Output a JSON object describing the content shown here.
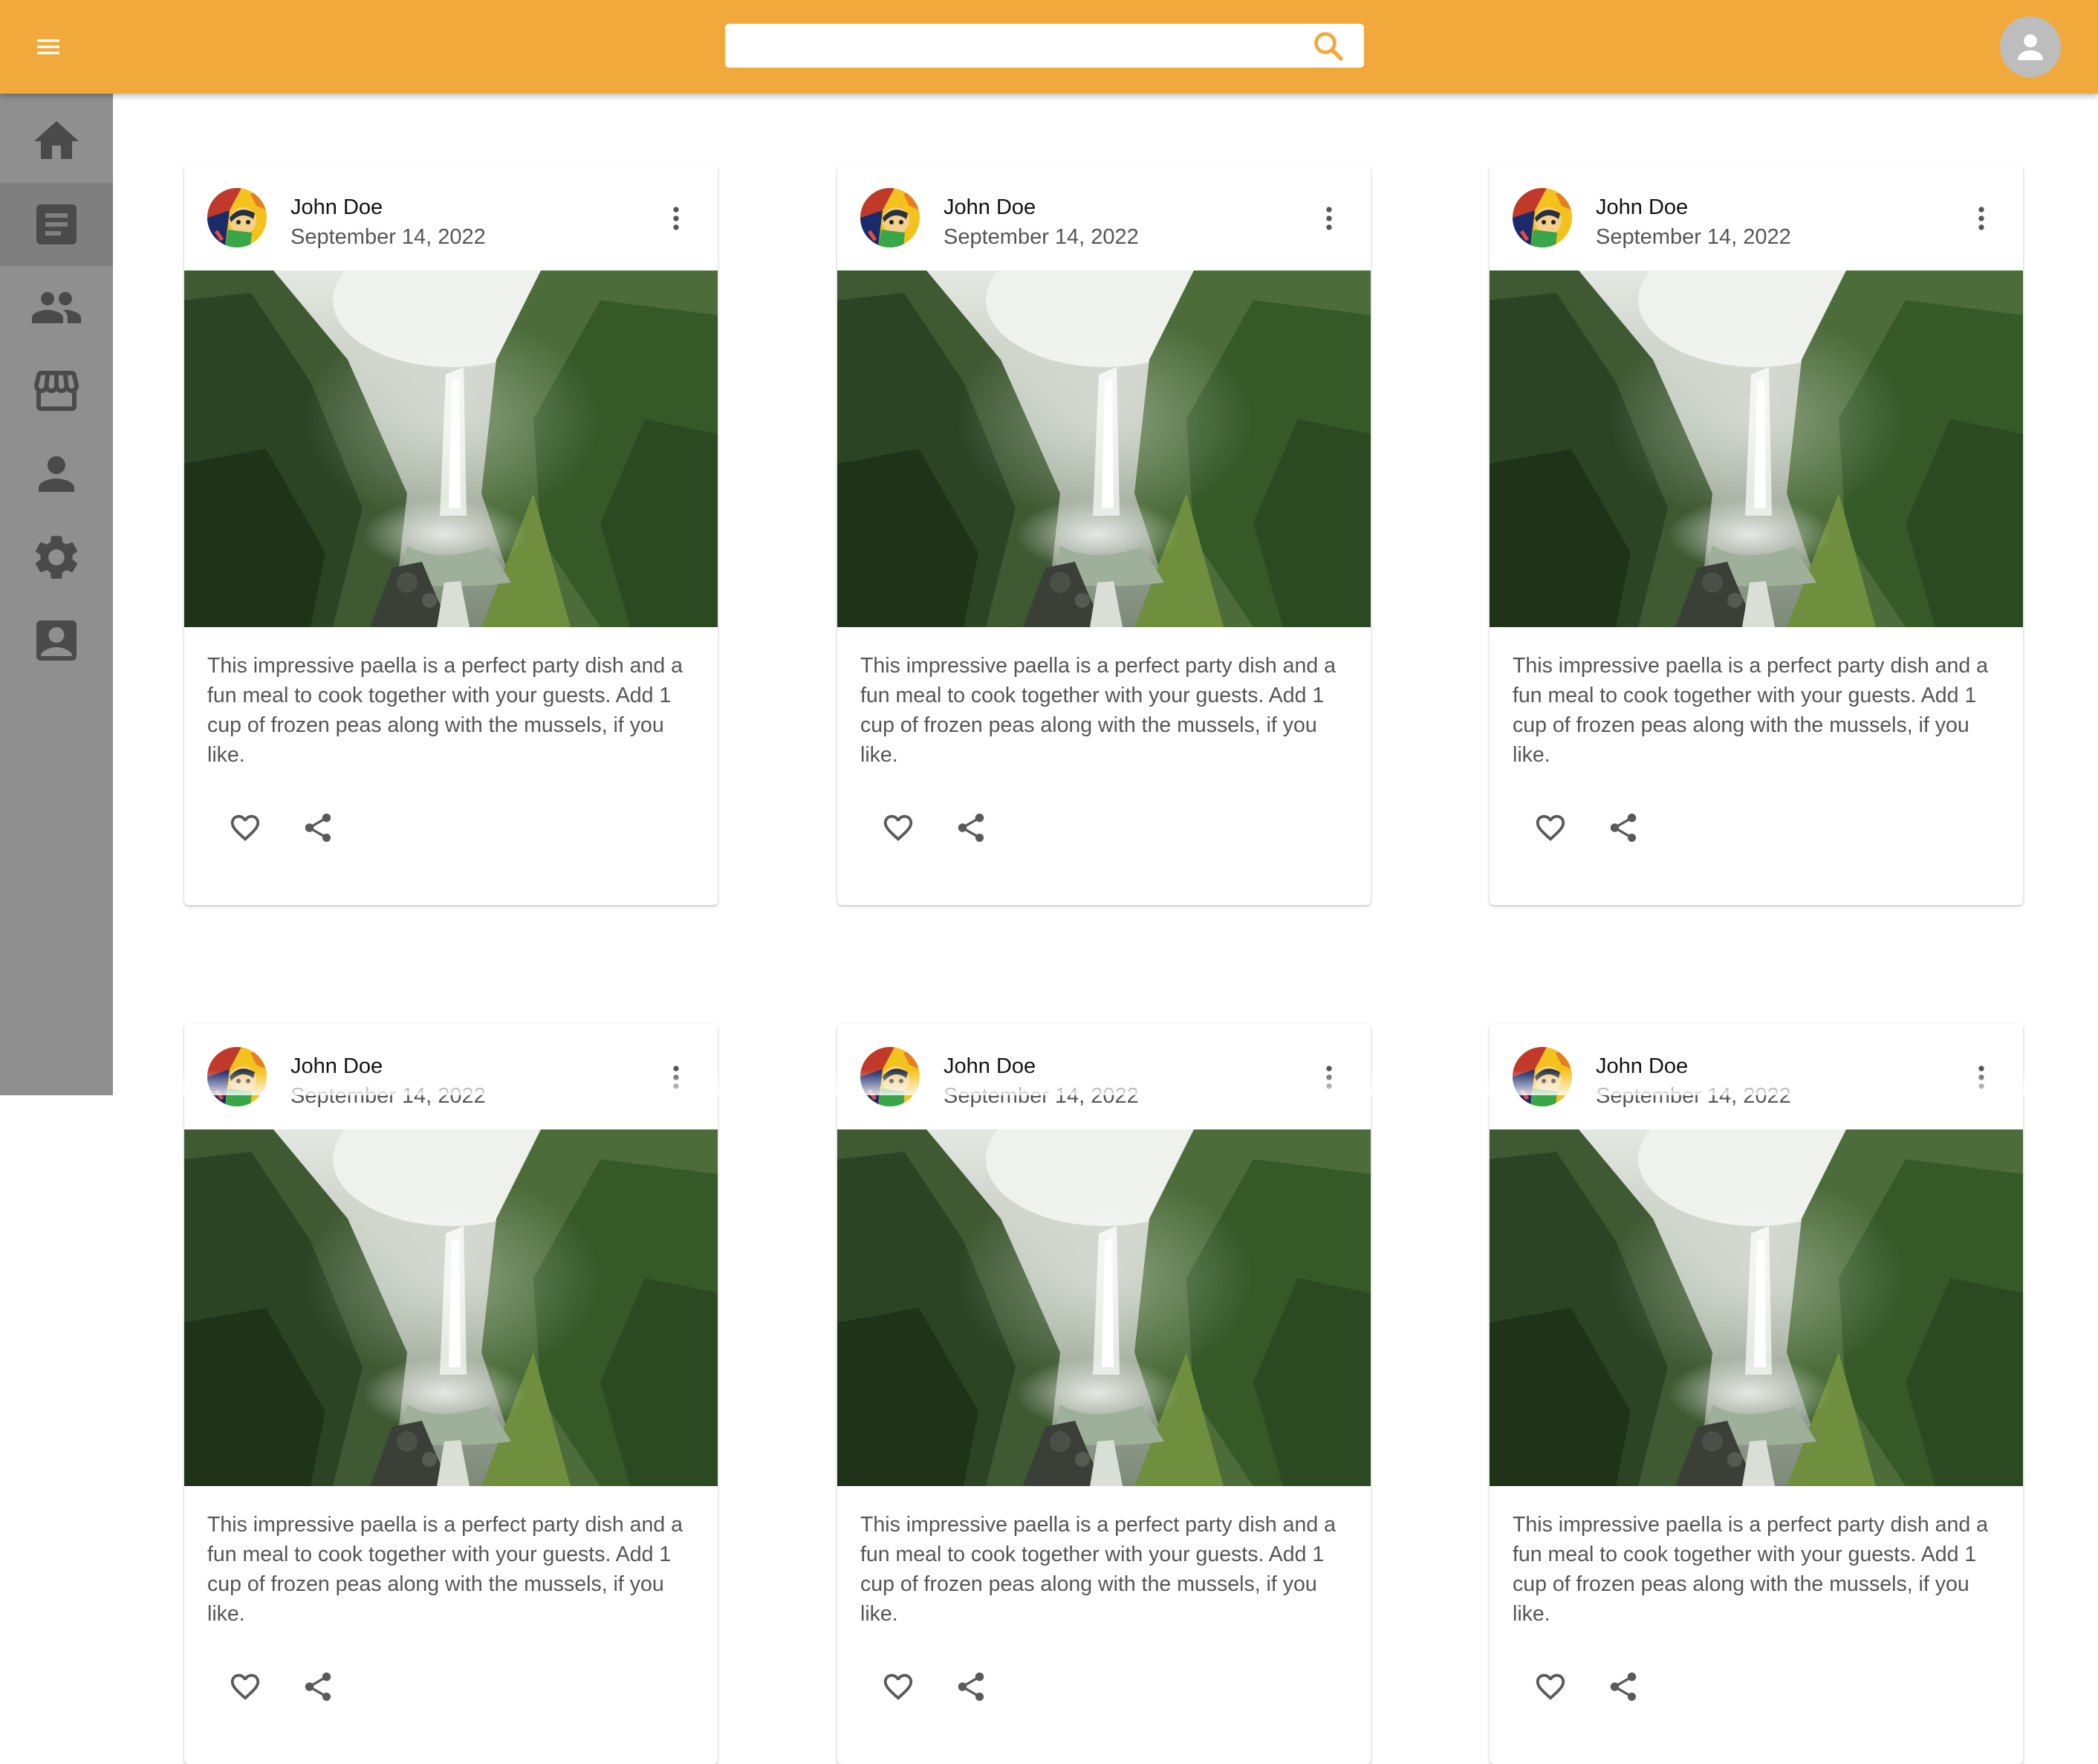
{
  "header": {
    "search": {
      "value": "",
      "placeholder": ""
    },
    "menu_icon": "menu-icon",
    "search_icon": "search-icon",
    "account_icon": "account-icon"
  },
  "sidebar": {
    "items": [
      {
        "icon": "home-icon",
        "active": false
      },
      {
        "icon": "article-icon",
        "active": true
      },
      {
        "icon": "people-icon",
        "active": false
      },
      {
        "icon": "store-icon",
        "active": false
      },
      {
        "icon": "person-icon",
        "active": false
      },
      {
        "icon": "settings-icon",
        "active": false
      },
      {
        "icon": "contact-icon",
        "active": false
      }
    ]
  },
  "cards": [
    {
      "author": "John Doe",
      "date": "September 14, 2022",
      "text": "This impressive paella is a perfect party dish and a fun meal to cook together with your guests. Add 1 cup of frozen peas along with the mussels, if you like."
    },
    {
      "author": "John Doe",
      "date": "September 14, 2022",
      "text": "This impressive paella is a perfect party dish and a fun meal to cook together with your guests. Add 1 cup of frozen peas along with the mussels, if you like."
    },
    {
      "author": "John Doe",
      "date": "September 14, 2022",
      "text": "This impressive paella is a perfect party dish and a fun meal to cook together with your guests. Add 1 cup of frozen peas along with the mussels, if you like."
    },
    {
      "author": "John Doe",
      "date": "September 14, 2022",
      "text": "This impressive paella is a perfect party dish and a fun meal to cook together with your guests. Add 1 cup of frozen peas along with the mussels, if you like."
    },
    {
      "author": "John Doe",
      "date": "September 14, 2022",
      "text": "This impressive paella is a perfect party dish and a fun meal to cook together with your guests. Add 1 cup of frozen peas along with the mussels, if you like."
    },
    {
      "author": "John Doe",
      "date": "September 14, 2022",
      "text": "This impressive paella is a perfect party dish and a fun meal to cook together with your guests. Add 1 cup of frozen peas along with the mussels, if you like."
    }
  ],
  "card_icons": {
    "more": "more-vert-icon",
    "like": "heart-icon",
    "share": "share-icon"
  },
  "colors": {
    "appbar": "#f2a93b",
    "sidebar": "#8f8f8f",
    "sidebar_active": "#7f7f7f",
    "icon": "#4a4a4a"
  }
}
